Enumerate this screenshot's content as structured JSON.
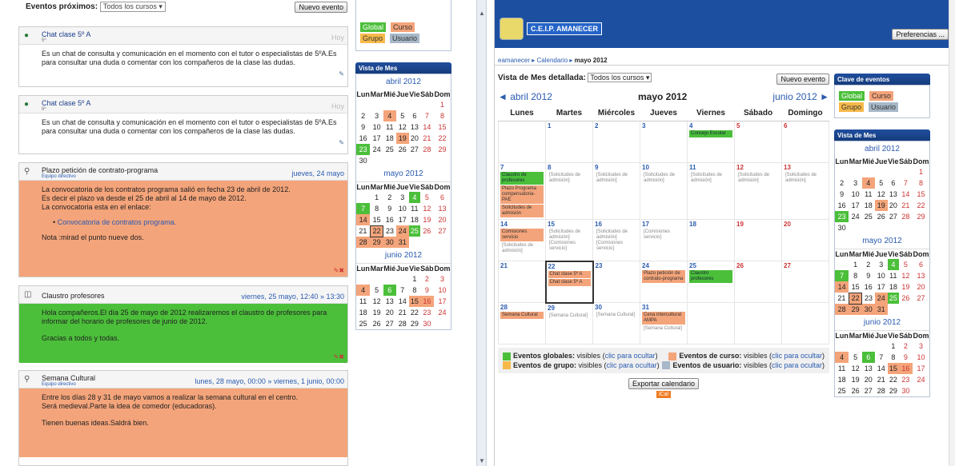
{
  "left": {
    "events_header": {
      "label": "Eventos próximos:",
      "select_value": "Todos los cursos",
      "new_event": "Nuevo evento"
    },
    "events": [
      {
        "title": "Chat clase 5º A",
        "subtitle": "5º",
        "date": "Hoy",
        "body": [
          "Es un chat de consulta y comunicación en el momento con el tutor o especialistas de 5ºA.Es para consultar una duda o comentar con los compañeros de la clase las dudas."
        ]
      },
      {
        "title": "Chat clase 5º A",
        "subtitle": "6º",
        "date": "Hoy",
        "body": [
          "Es un chat de consulta y comunicación en el momento con el tutor o especialistas de 5ºA.Es para consultar una duda o comentar con los compañeros de la clase las dudas."
        ]
      },
      {
        "title": "Plazo petición de contrato-programa",
        "subtitle": "Equipo directivo",
        "date": "jueves, 24 mayo",
        "body": [
          "La convocatoria de los contratos programa salió en fecha 23 de abril de 2012.",
          "Es decir el plazo va desde el 25 de abril al 14 de mayo de 2012.",
          "La convocatoria esta en el enlace:"
        ],
        "link": "Convocatoria de contratos programa.",
        "note": "Nota :mirad el punto nueve dos."
      },
      {
        "title": "Claustro profesores",
        "subtitle": "",
        "date": "viernes, 25 mayo, 12:40 » 13:30",
        "body": [
          "Hola compañeros.El día 25 de mayo de 2012 realizaremos el claustro de profesores para informar del horario de profesores de junio de 2012.",
          "Gracias a todos y todas."
        ]
      },
      {
        "title": "Semana Cultural",
        "subtitle": "Equipo directivo",
        "date": "lunes, 28 mayo, 00:00 » viernes, 1 junio, 00:00",
        "body": [
          "Entre los días 28 y 31 de mayo vamos a realizar la semana cultural en el centro.",
          "Será medieval.Parte la idea de comedor (educadoras).",
          "Tienen buenas ideas.Saldrá bien."
        ]
      }
    ],
    "legend": {
      "global": "Global",
      "curso": "Curso",
      "grupo": "Grupo",
      "usuario": "Usuario"
    },
    "vista_mes": "Vista de Mes",
    "months": [
      "abril 2012",
      "mayo 2012",
      "junio 2012"
    ]
  },
  "right": {
    "logo_text": "C.E.I.P. AMANECER",
    "preferences": "Preferencias ...",
    "breadcrumb": [
      "eamanecer",
      "Calendario",
      "mayo 2012"
    ],
    "detail_label": "Vista de Mes detallada:",
    "detail_select": "Todos los cursos",
    "new_event": "Nuevo evento",
    "prev_month": "◄ abril 2012",
    "current_month": "mayo 2012",
    "next_month": "junio 2012 ►",
    "weekdays": [
      "Lunes",
      "Martes",
      "Miércoles",
      "Jueves",
      "Viernes",
      "Sábado",
      "Domingo"
    ],
    "clave_title": "Clave de eventos",
    "vista_mes": "Vista de Mes",
    "key": {
      "global": "Eventos globales:",
      "global_v": "visibles",
      "global_link": "clic para ocultar",
      "curso": "Eventos de curso:",
      "curso_v": "visibles",
      "curso_link": "clic para ocultar",
      "grupo": "Eventos de grupo:",
      "grupo_v": "visibles",
      "grupo_link": "clic para ocultar",
      "usuario": "Eventos de usuario:",
      "usuario_v": "visibles",
      "usuario_link": "clic para ocultar"
    },
    "export": "Exportar calendario",
    "ical": "iCal"
  },
  "colors": {
    "global": "#4bbf3a",
    "curso": "#f4a47a",
    "grupo": "#f6b94a",
    "usuario": "#a7b8c8",
    "header": "#1d4fa1"
  }
}
